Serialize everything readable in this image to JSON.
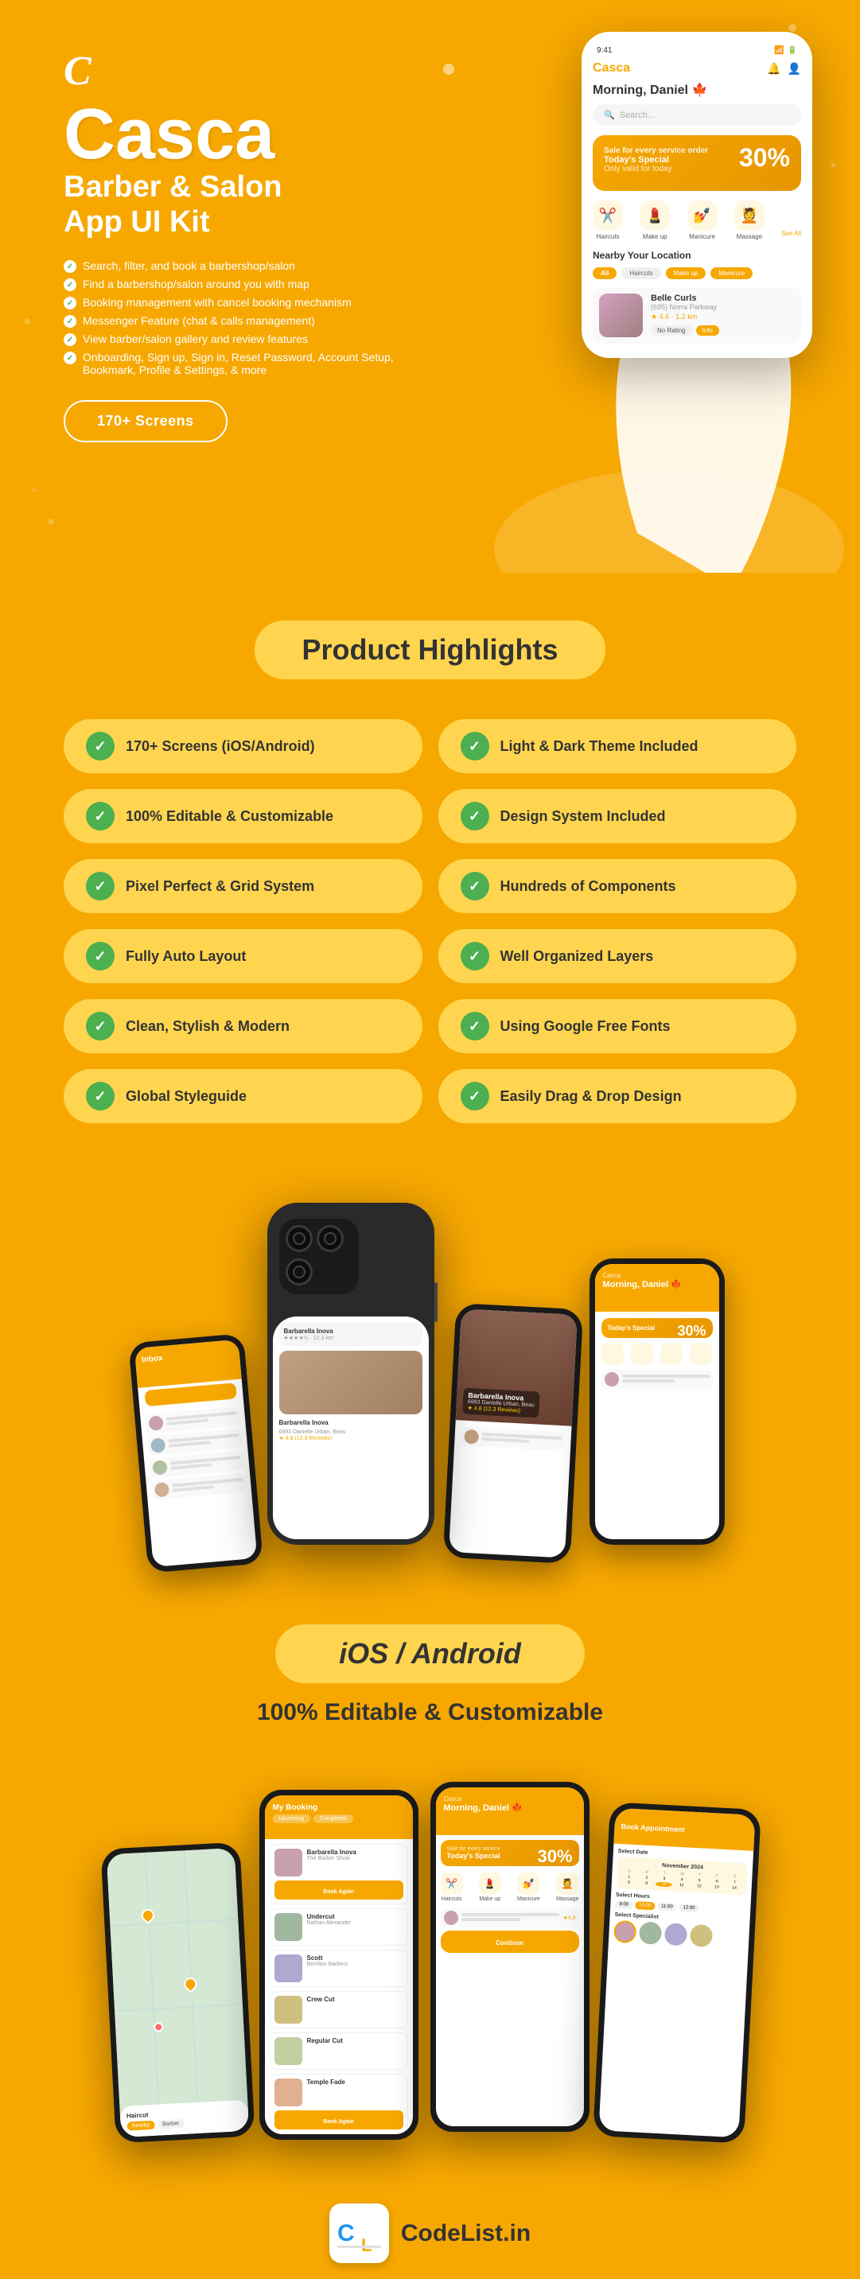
{
  "hero": {
    "logo": "C",
    "app_name": "Casca",
    "subtitle1": "Barber & Salon",
    "subtitle2": "App UI Kit",
    "features": [
      "Search, filter, and book a barbershop/salon",
      "Find a barbershop/salon around you with map",
      "Booking management with cancel booking mechanism",
      "Messenger Feature (chat & calls management)",
      "View barber/salon gallery and review features",
      "Onboarding, Sign up, Sign in, Reset Password, Account Setup, Bookmark, Profile & Settings, & more"
    ],
    "cta_label": "170+ Screens",
    "phone_time": "9:41",
    "phone_app_label": "Casca",
    "phone_greeting": "Morning, Daniel 🍁",
    "phone_search_placeholder": "Search...",
    "phone_special_title": "Today's Special",
    "phone_discount": "30%",
    "phone_categories": [
      "Haircuts",
      "Make up",
      "Manicure",
      "Massage"
    ],
    "phone_nearby": "Nearby Your Location",
    "phone_filters": [
      "All",
      "Haircuts",
      "Make up",
      "Manicure"
    ],
    "phone_salon_name": "Belle Curls",
    "phone_salon_addr": "(695) Norra Parkway",
    "phone_salon_distance": "1.2 km",
    "phone_salon_rating": "4.6"
  },
  "highlights": {
    "section_title": "Product Highlights",
    "items_left": [
      "170+ Screens (iOS/Android)",
      "100% Editable & Customizable",
      "Pixel Perfect & Grid System",
      "Fully Auto Layout",
      "Clean, Stylish & Modern",
      "Global Styleguide"
    ],
    "items_right": [
      "Light & Dark Theme Included",
      "Design System Included",
      "Hundreds of Components",
      "Well Organized Layers",
      "Using Google Free Fonts",
      "Easily Drag & Drop Design"
    ]
  },
  "platform": {
    "pill_label": "iOS / Android",
    "subtitle": "100% Editable & Customizable"
  },
  "footer": {
    "logo_text": "CL",
    "brand_name": "CodeList.in"
  }
}
